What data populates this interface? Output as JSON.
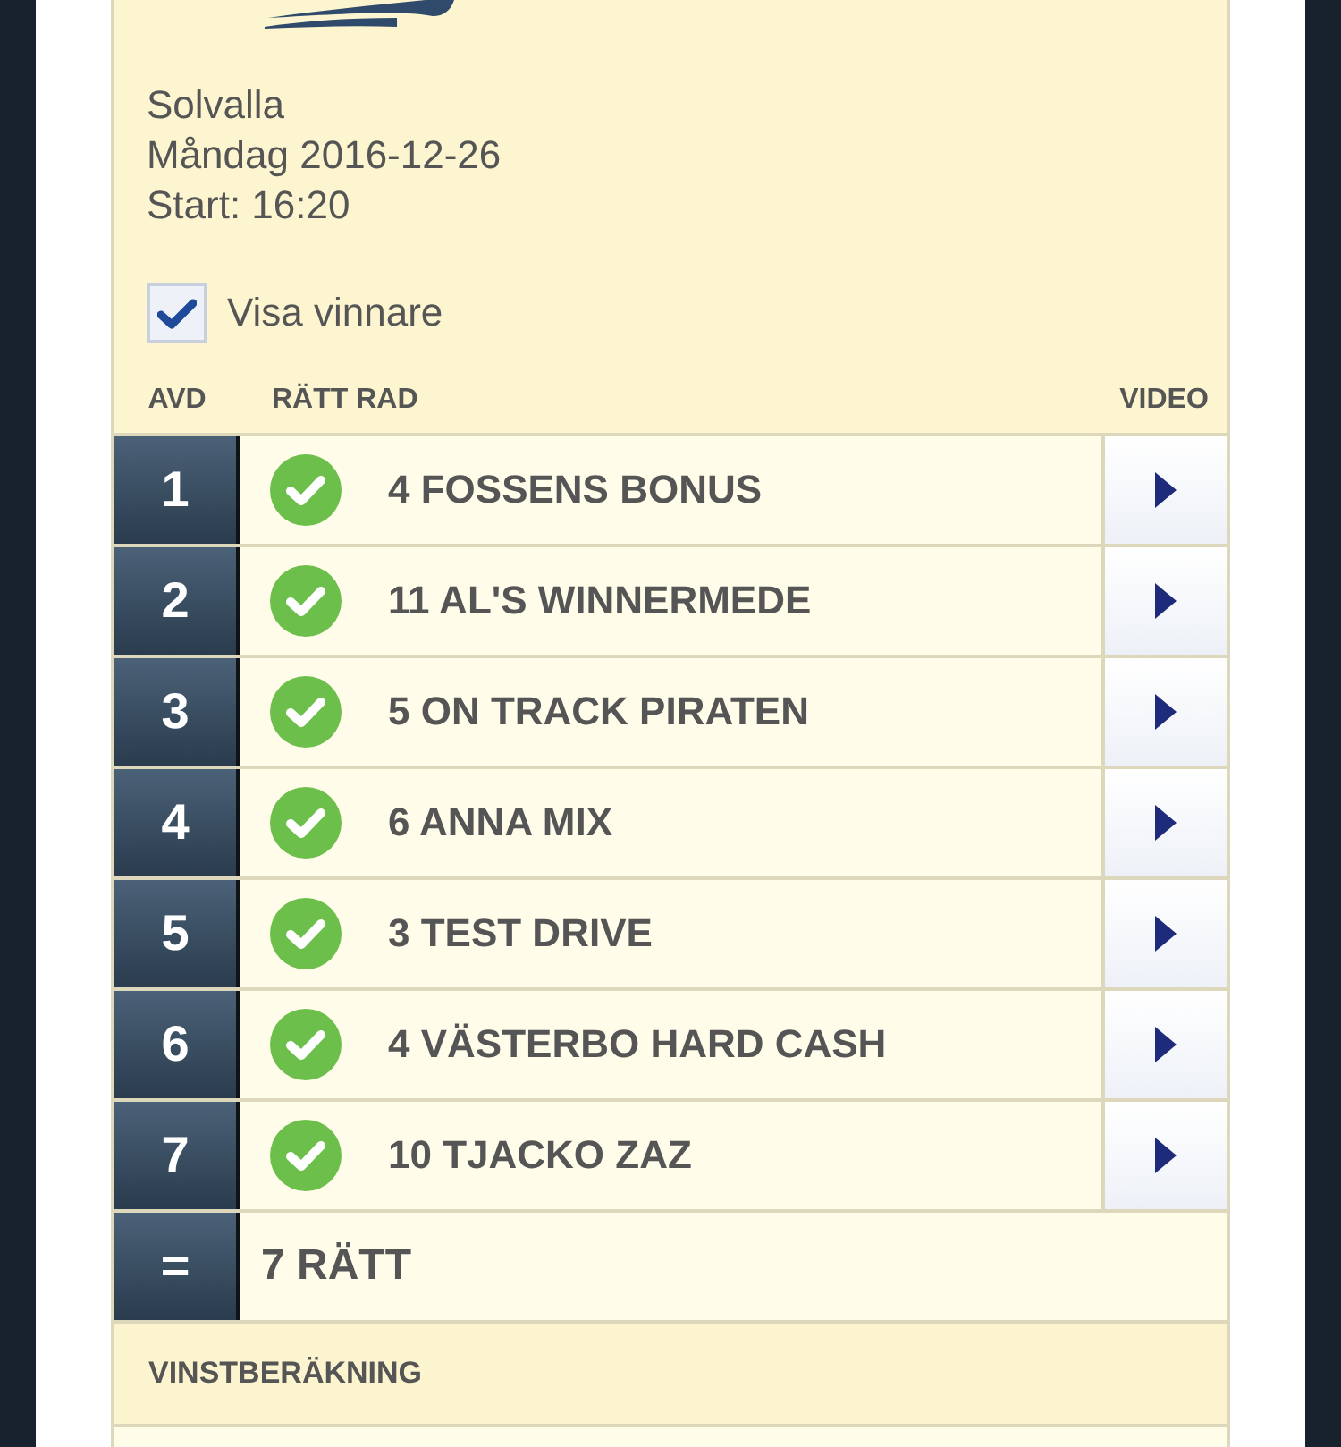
{
  "header": {
    "track": "Solvalla",
    "date": "Måndag 2016-12-26",
    "start": "Start: 16:20"
  },
  "show_winners": {
    "label": "Visa vinnare",
    "checked": true
  },
  "table": {
    "columns": [
      "AVD",
      "RÄTT RAD",
      "VIDEO"
    ],
    "rows": [
      {
        "race": "1",
        "correct": true,
        "winner": "4 FOSSENS BONUS"
      },
      {
        "race": "2",
        "correct": true,
        "winner": "11 AL'S WINNERMEDE"
      },
      {
        "race": "3",
        "correct": true,
        "winner": "5 ON TRACK PIRATEN"
      },
      {
        "race": "4",
        "correct": true,
        "winner": "6 ANNA MIX"
      },
      {
        "race": "5",
        "correct": true,
        "winner": "3 TEST DRIVE"
      },
      {
        "race": "6",
        "correct": true,
        "winner": "4 VÄSTERBO HARD CASH"
      },
      {
        "race": "7",
        "correct": true,
        "winner": "10 TJACKO ZAZ"
      }
    ],
    "summary": {
      "symbol": "=",
      "result": "7 RÄTT"
    }
  },
  "sections": [
    {
      "title": "VINSTBERÄKNING"
    }
  ]
}
